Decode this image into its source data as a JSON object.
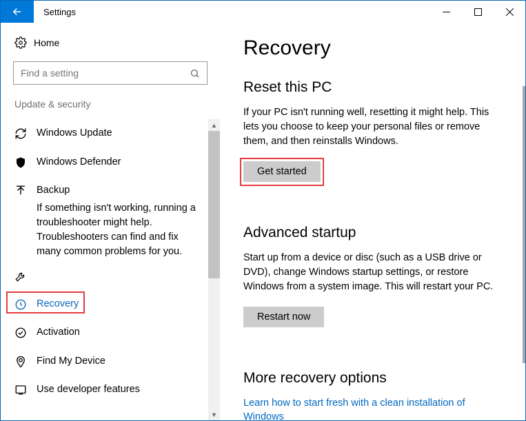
{
  "titlebar": {
    "title": "Settings"
  },
  "sidebar": {
    "home_label": "Home",
    "search_placeholder": "Find a setting",
    "category_label": "Update & security",
    "help_text": "If something isn't working, running a troubleshooter might help. Troubleshooters can find and fix many common problems for you.",
    "items": {
      "windows_update": "Windows Update",
      "windows_defender": "Windows Defender",
      "backup": "Backup",
      "troubleshoot": "",
      "recovery": "Recovery",
      "activation": "Activation",
      "find_my_device": "Find My Device",
      "developer": "Use developer features"
    }
  },
  "main": {
    "header": "Recovery",
    "reset": {
      "title": "Reset this PC",
      "body": "If your PC isn't running well, resetting it might help. This lets you choose to keep your personal files or remove them, and then reinstalls Windows.",
      "button": "Get started"
    },
    "advanced": {
      "title": "Advanced startup",
      "body": "Start up from a device or disc (such as a USB drive or DVD), change Windows startup settings, or restore Windows from a system image. This will restart your PC.",
      "button": "Restart now"
    },
    "more": {
      "title": "More recovery options",
      "link": "Learn how to start fresh with a clean installation of Windows"
    }
  }
}
